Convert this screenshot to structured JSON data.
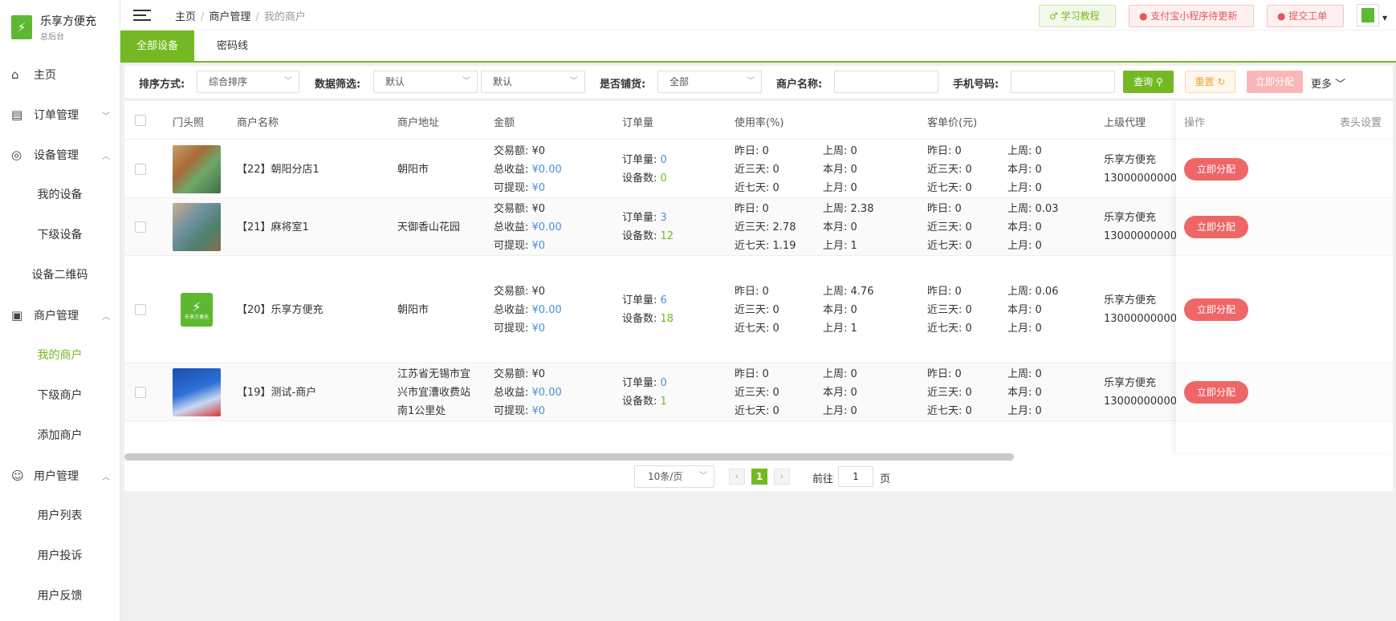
{
  "brand": {
    "title": "乐享方便充",
    "subtitle": "总后台",
    "logo_text": "乐享方便充"
  },
  "sidebar": {
    "home": "主页",
    "orders": "订单管理",
    "devices": "设备管理",
    "my_devices": "我的设备",
    "sub_devices": "下级设备",
    "device_qr": "设备二维码",
    "merchants": "商户管理",
    "my_merchants": "我的商户",
    "sub_merchants": "下级商户",
    "add_merchant": "添加商户",
    "users": "用户管理",
    "user_list": "用户列表",
    "user_complaints": "用户投诉",
    "user_feedback": "用户反馈"
  },
  "breadcrumb": {
    "home": "主页",
    "section": "商户管理",
    "current": "我的商户"
  },
  "topbar": {
    "learn": "学习教程",
    "alipay": "支付宝小程序待更新",
    "ticket": "提交工单"
  },
  "tabs": {
    "all_devices": "全部设备",
    "password_line": "密码线"
  },
  "filters": {
    "sort_label": "排序方式:",
    "sort_value": "综合排序",
    "data_label": "数据筛选:",
    "data_value1": "默认",
    "data_value2": "默认",
    "stock_label": "是否铺货:",
    "stock_value": "全部",
    "name_label": "商户名称:",
    "phone_label": "手机号码:",
    "query": "查询",
    "reset": "重置",
    "assign": "立即分配",
    "more": "更多"
  },
  "table": {
    "headers": {
      "photo": "门头照",
      "name": "商户名称",
      "address": "商户地址",
      "amount": "金额",
      "orders": "订单量",
      "usage": "使用率(%)",
      "unit_price": "客单价(元)",
      "agent": "上级代理",
      "action": "操作",
      "settings": "表头设置"
    },
    "labels": {
      "trade": "交易额:",
      "revenue": "总收益:",
      "withdrawable": "可提现:",
      "order_count": "订单量:",
      "device_count": "设备数:",
      "yesterday": "昨日:",
      "last_week": "上周:",
      "three_days": "近三天:",
      "this_month": "本月:",
      "seven_days": "近七天:",
      "last_month": "上月:"
    },
    "rows": [
      {
        "name": "【22】朝阳分店1",
        "address": "朝阳市",
        "trade": "¥0",
        "revenue": "¥0.00",
        "withdrawable": "¥0",
        "order_count": "0",
        "device_count": "0",
        "u_yesterday": "0",
        "u_last_week": "0",
        "u_three_days": "0",
        "u_this_month": "0",
        "u_seven_days": "0",
        "u_last_month": "0",
        "p_yesterday": "0",
        "p_last_week": "0",
        "p_three_days": "0",
        "p_this_month": "0",
        "p_seven_days": "0",
        "p_last_month": "0",
        "agent_name": "乐享方便充",
        "agent_phone": "13000000000",
        "action": "立即分配"
      },
      {
        "name": "【21】麻将室1",
        "address": "天御香山花园",
        "trade": "¥0",
        "revenue": "¥0.00",
        "withdrawable": "¥0",
        "order_count": "3",
        "device_count": "12",
        "u_yesterday": "0",
        "u_last_week": "2.38",
        "u_three_days": "2.78",
        "u_this_month": "0",
        "u_seven_days": "1.19",
        "u_last_month": "1",
        "p_yesterday": "0",
        "p_last_week": "0.03",
        "p_three_days": "0",
        "p_this_month": "0",
        "p_seven_days": "0",
        "p_last_month": "0",
        "agent_name": "乐享方便充",
        "agent_phone": "13000000000",
        "action": "立即分配"
      },
      {
        "name": "【20】乐享方便充",
        "address": "朝阳市",
        "trade": "¥0",
        "revenue": "¥0.00",
        "withdrawable": "¥0",
        "order_count": "6",
        "device_count": "18",
        "u_yesterday": "0",
        "u_last_week": "4.76",
        "u_three_days": "0",
        "u_this_month": "0",
        "u_seven_days": "0",
        "u_last_month": "1",
        "p_yesterday": "0",
        "p_last_week": "0.06",
        "p_three_days": "0",
        "p_this_month": "0",
        "p_seven_days": "0",
        "p_last_month": "0",
        "agent_name": "乐享方便充",
        "agent_phone": "13000000000",
        "action": "立即分配",
        "logo_text": "乐享方便充"
      },
      {
        "name": "【19】测试-商户",
        "address": "江苏省无锡市宜兴市宜漕收费站南1公里处",
        "trade": "¥0",
        "revenue": "¥0.00",
        "withdrawable": "¥0",
        "order_count": "0",
        "device_count": "1",
        "u_yesterday": "0",
        "u_last_week": "0",
        "u_three_days": "0",
        "u_this_month": "0",
        "u_seven_days": "0",
        "u_last_month": "0",
        "p_yesterday": "0",
        "p_last_week": "0",
        "p_three_days": "0",
        "p_this_month": "0",
        "p_seven_days": "0",
        "p_last_month": "0",
        "agent_name": "乐享方便充",
        "agent_phone": "13000000000",
        "action": "立即分配"
      }
    ]
  },
  "pagination": {
    "page_size": "10条/页",
    "current_page": "1",
    "goto_label": "前往",
    "goto_value": "1",
    "page_suffix": "页"
  },
  "colors": {
    "accent": "#74b923",
    "danger": "#ef6666",
    "link": "#4a8fe0"
  }
}
